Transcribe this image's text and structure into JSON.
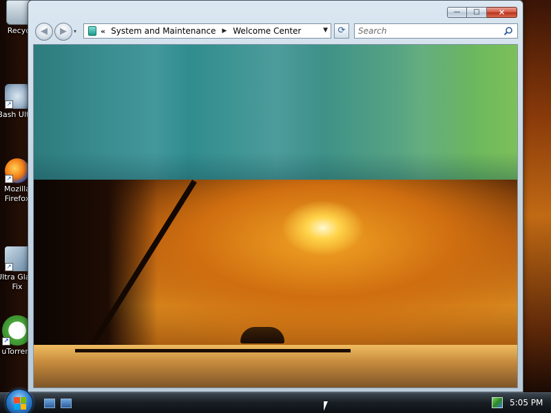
{
  "desktop": {
    "icons": [
      {
        "label": "Recyc",
        "icon": "recycle-bin-icon"
      },
      {
        "label": "Bash Ultra",
        "icon": "bash-app-icon"
      },
      {
        "label": "Mozilla Firefox",
        "icon": "firefox-icon"
      },
      {
        "label": "Ultra Glass Fix",
        "icon": "ultra-glass-icon"
      },
      {
        "label": "uTorrent",
        "icon": "utorrent-icon"
      }
    ],
    "shortcut_glyph": "↗"
  },
  "window": {
    "caption_buttons": {
      "minimize": "—",
      "maximize": "□",
      "close": "✕"
    },
    "nav": {
      "back_glyph": "◀",
      "forward_glyph": "▶",
      "history_glyph": "▾"
    },
    "address": {
      "overflow_chevron": "«",
      "breadcrumbs": [
        "System and Maintenance",
        "Welcome Center"
      ],
      "separator_glyph": "▶",
      "dropdown_glyph": "▼"
    },
    "refresh_glyph": "⟳",
    "search": {
      "placeholder": "Search"
    }
  },
  "taskbar": {
    "clock": "5:05 PM",
    "quick_launch": [
      "show-desktop-icon",
      "switch-windows-icon"
    ],
    "tray": [
      "network-icon"
    ]
  },
  "colors": {
    "banner_start": "#2d7b7d",
    "banner_end": "#7cc05a",
    "close_button": "#d2553f"
  }
}
